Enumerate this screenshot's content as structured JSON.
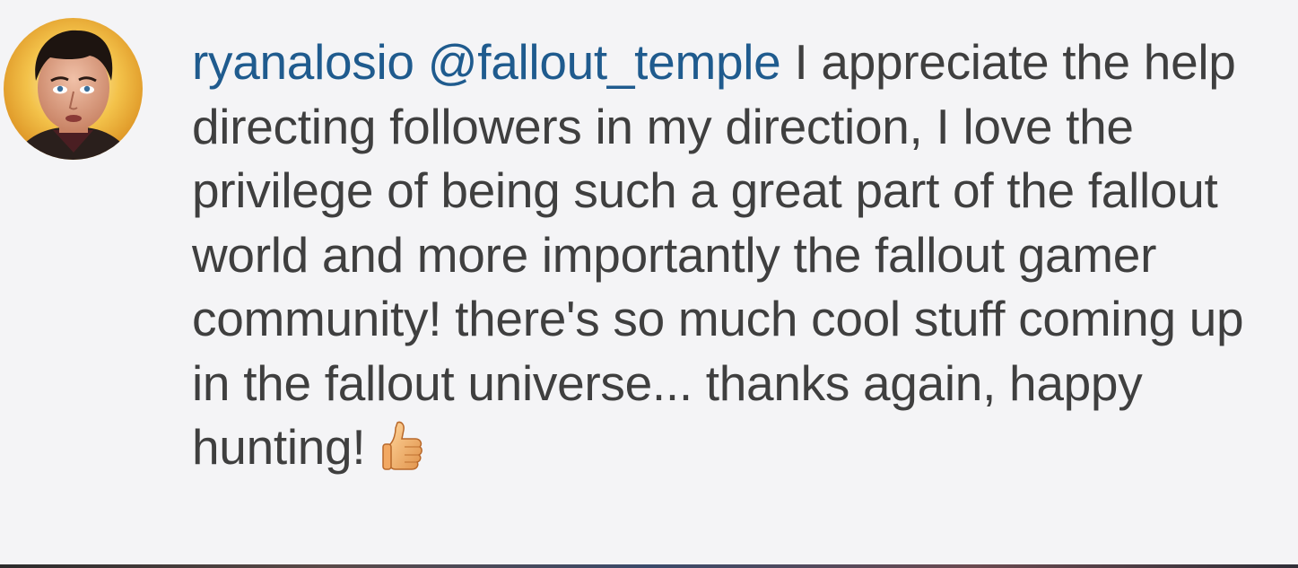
{
  "comment": {
    "username": "ryanalosio",
    "mention": "@fallout_temple",
    "text": " I appreciate the help directing followers in my direction, I love the privilege of being such a great part of the fallout world and more importantly the fallout gamer community! there's so much cool stuff coming up in the fallout universe... thanks again, happy hunting!",
    "emoji": "thumbs-up-icon"
  },
  "colors": {
    "link": "#1f5b8e",
    "text": "#3f3f3f",
    "background": "#f4f4f6"
  }
}
